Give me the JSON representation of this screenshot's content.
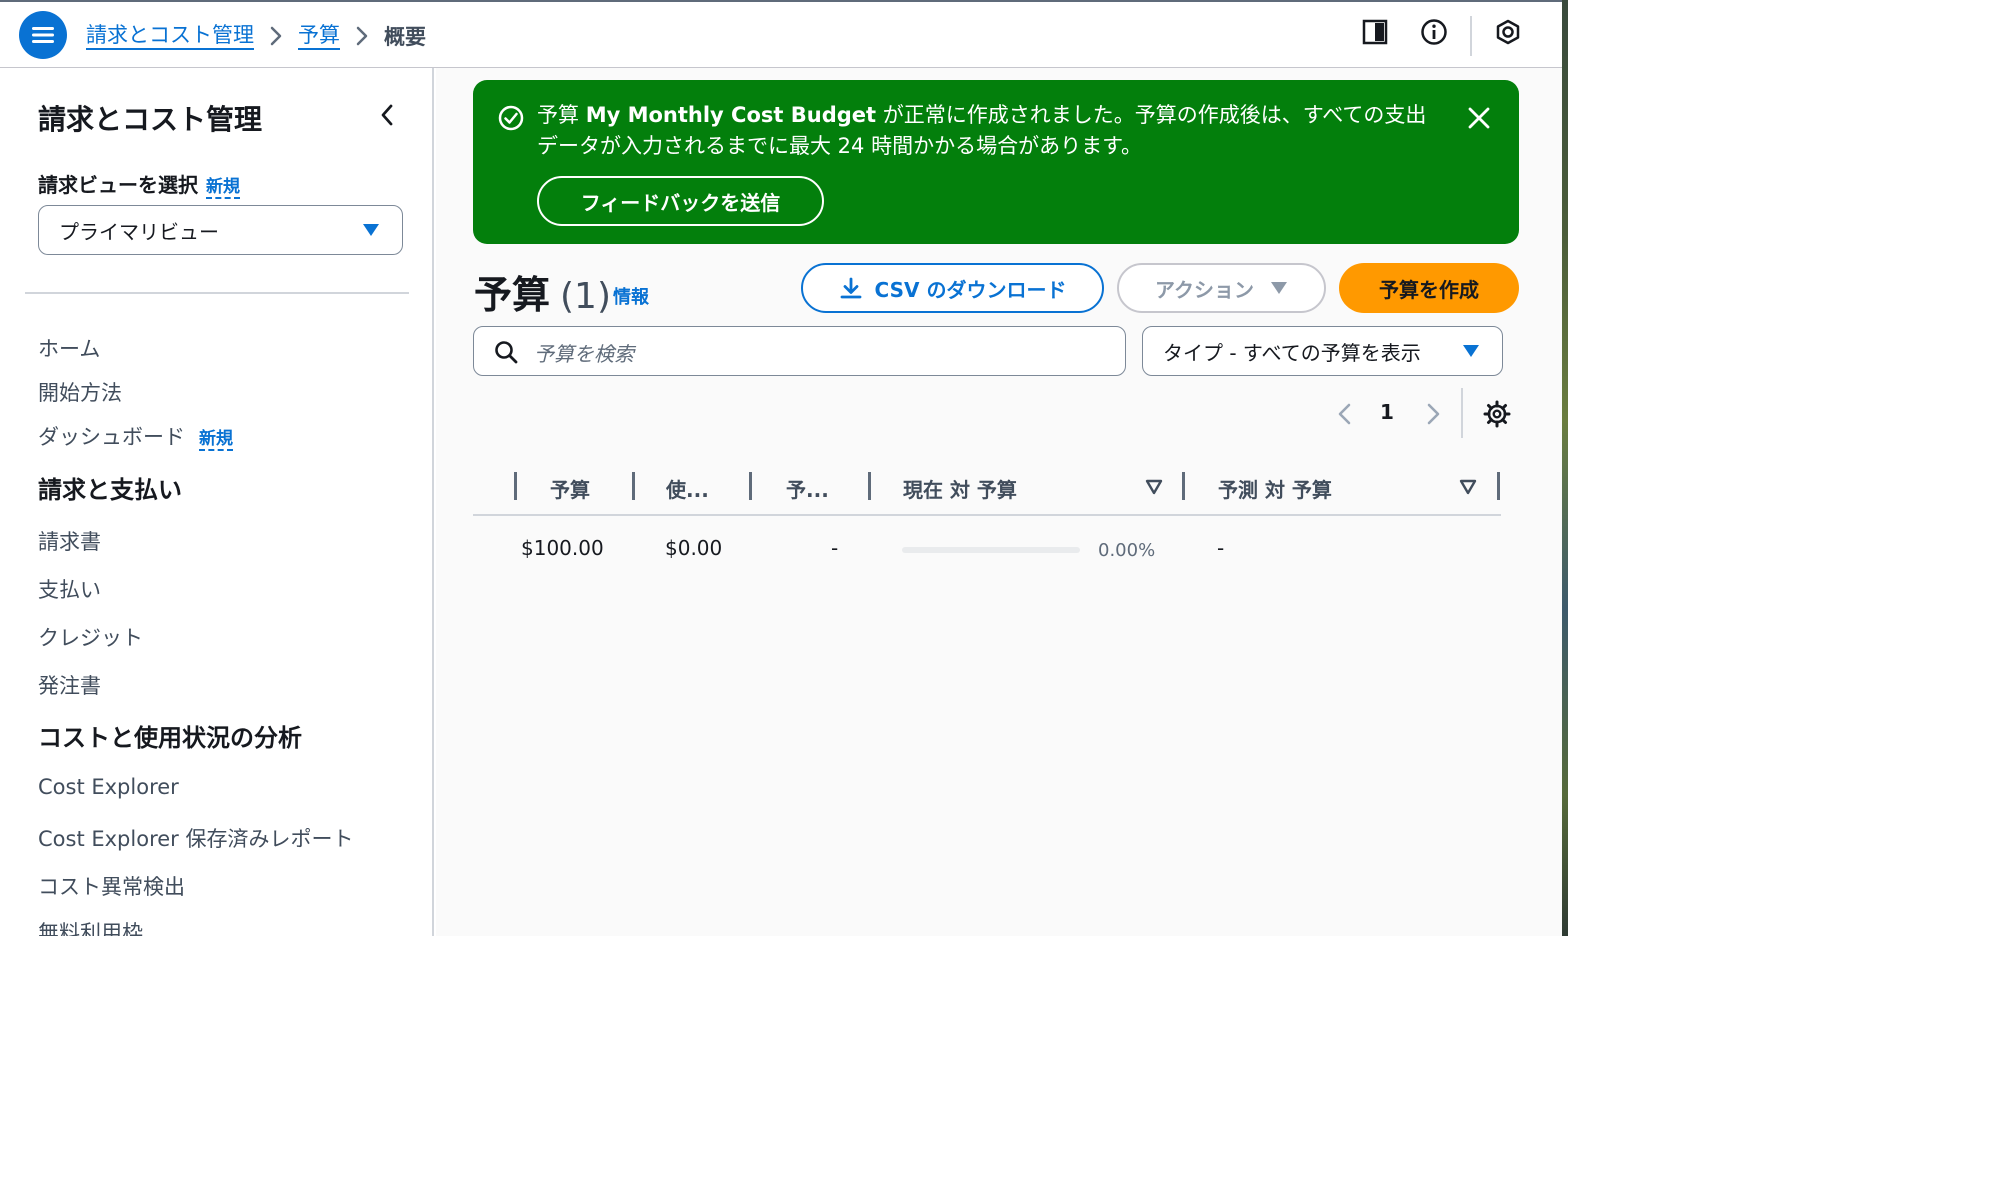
{
  "breadcrumbs": {
    "root": "請求とコスト管理",
    "parent": "予算",
    "current": "概要"
  },
  "sidebar": {
    "title": "請求とコスト管理",
    "view_label": "請求ビューを選択",
    "view_new": "新規",
    "view_selected": "プライマリビュー",
    "items_top": [
      {
        "label": "ホーム"
      },
      {
        "label": "開始方法"
      },
      {
        "label": "ダッシュボード",
        "badge": "新規"
      }
    ],
    "section_billing": "請求と支払い",
    "items_billing": [
      {
        "label": "請求書"
      },
      {
        "label": "支払い"
      },
      {
        "label": "クレジット"
      },
      {
        "label": "発注書"
      }
    ],
    "section_cost": "コストと使用状況の分析",
    "items_cost": [
      {
        "label": "Cost Explorer"
      },
      {
        "label": "Cost Explorer 保存済みレポート"
      },
      {
        "label": "コスト異常検出"
      },
      {
        "label": "無料利用枠"
      }
    ]
  },
  "flash": {
    "msg_prefix": "予算 ",
    "budget_name": "My Monthly Cost Budget",
    "msg_suffix": " が正常に作成されました。予算の作成後は、すべての支出データが入力されるまでに最大 24 時間かかる場合があります。",
    "feedback_button": "フィードバックを送信",
    "color": "#037f0c"
  },
  "header": {
    "title": "予算",
    "count": "(1)",
    "info": "情報",
    "csv_button": "CSV のダウンロード",
    "action_button": "アクション",
    "create_button": "予算を作成"
  },
  "filters": {
    "search_placeholder": "予算を検索",
    "type_select": "タイプ - すべての予算を表示"
  },
  "pagination": {
    "current_page": "1"
  },
  "table": {
    "columns": [
      "予算",
      "使...",
      "予...",
      "現在 対 予算",
      "予測 対 予算"
    ],
    "rows": [
      {
        "budget": "$100.00",
        "used": "$0.00",
        "forecast": "-",
        "current_vs_budget_progress": 0.0,
        "current_vs_budget_pct": "0.00%",
        "forecast_vs_budget": "-"
      }
    ]
  },
  "colors": {
    "accent": "#0972d3",
    "primary_button": "#ff9900",
    "success": "#037f0c"
  }
}
